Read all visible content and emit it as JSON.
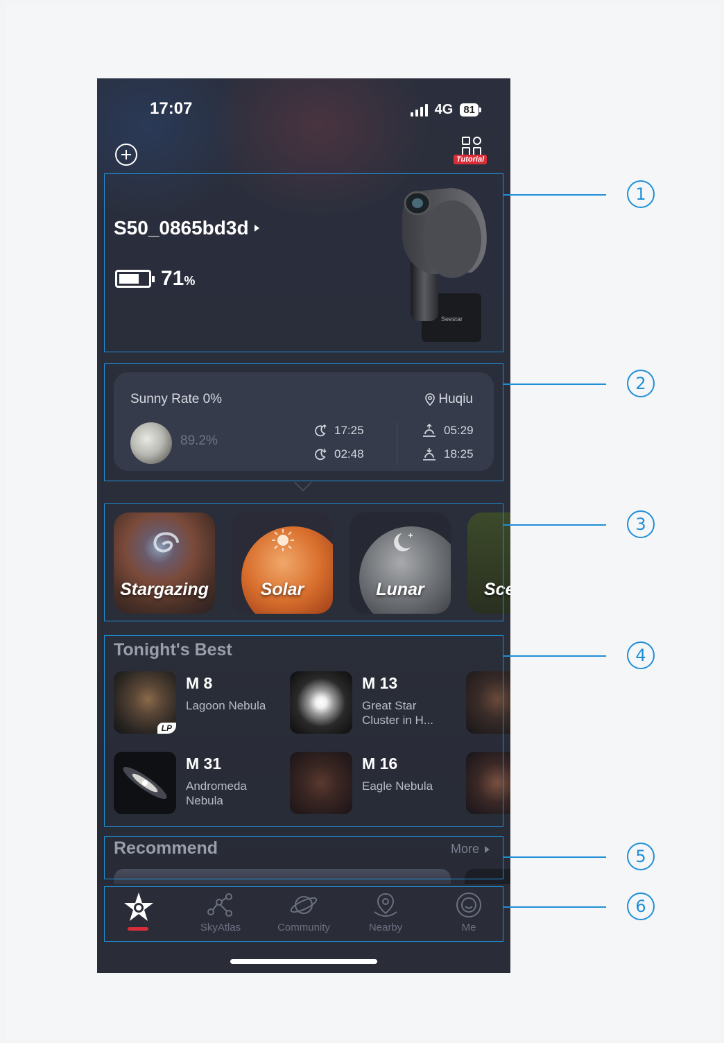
{
  "status": {
    "time": "17:07",
    "network": "4G",
    "battery": "81"
  },
  "header": {
    "tutorial_label": "Tutorial"
  },
  "device": {
    "name": "S50_0865bd3d",
    "battery_value": "71",
    "battery_unit": "%",
    "battery_level": 0.71,
    "brand": "Seestar"
  },
  "weather": {
    "sunny_rate": "Sunny Rate 0%",
    "location": "Huqiu",
    "moon_illumination": "89.2%",
    "moonrise": "17:25",
    "moonset": "02:48",
    "sunrise": "05:29",
    "sunset": "18:25"
  },
  "modes": [
    {
      "label": "Stargazing"
    },
    {
      "label": "Solar"
    },
    {
      "label": "Lunar"
    },
    {
      "label": "Sce"
    }
  ],
  "tonights_best": {
    "title": "Tonight's Best",
    "items": [
      {
        "id": "M 8",
        "name": "Lagoon Nebula",
        "badge": "LP"
      },
      {
        "id": "M 13",
        "name": "Great Star Cluster in H..."
      },
      {
        "id": "M 31",
        "name": "Andromeda Nebula"
      },
      {
        "id": "M 16",
        "name": "Eagle Nebula"
      }
    ]
  },
  "recommend": {
    "title": "Recommend",
    "more_label": "More"
  },
  "tabbar": {
    "items": [
      {
        "label": ""
      },
      {
        "label": "SkyAtlas"
      },
      {
        "label": "Community"
      },
      {
        "label": "Nearby"
      },
      {
        "label": "Me"
      }
    ]
  },
  "callouts": [
    "1",
    "2",
    "3",
    "4",
    "5",
    "6"
  ],
  "colors": {
    "annotation": "#1f8fd8",
    "accent": "#d92e3a",
    "background": "#2a2e3b"
  }
}
